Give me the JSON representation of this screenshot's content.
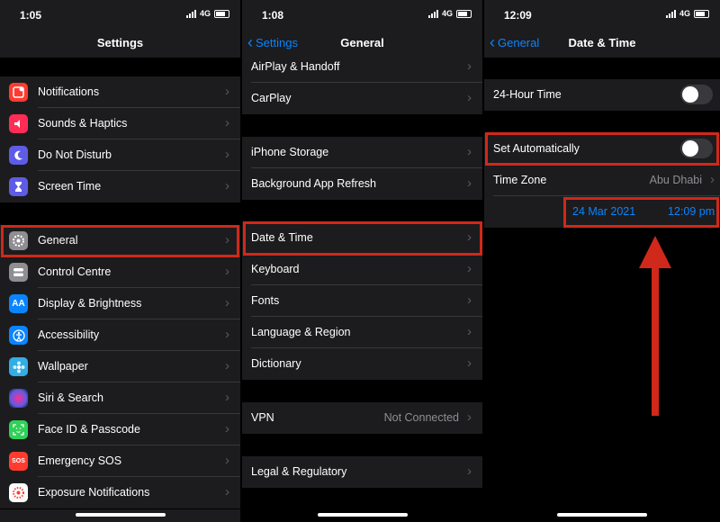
{
  "panels": {
    "p1": {
      "status_time": "1:05",
      "network": "4G",
      "title": "Settings",
      "items": [
        {
          "label": "Notifications",
          "icon": "notifications-icon",
          "color": "#ff3b30"
        },
        {
          "label": "Sounds & Haptics",
          "icon": "sounds-icon",
          "color": "#ff2d55"
        },
        {
          "label": "Do Not Disturb",
          "icon": "moon-icon",
          "color": "#5e5ce6"
        },
        {
          "label": "Screen Time",
          "icon": "hourglass-icon",
          "color": "#5e5ce6"
        },
        {
          "label": "General",
          "icon": "gear-icon",
          "color": "#8e8e93"
        },
        {
          "label": "Control Centre",
          "icon": "control-centre-icon",
          "color": "#8e8e93"
        },
        {
          "label": "Display & Brightness",
          "icon": "display-icon",
          "color": "#0a84ff",
          "glyph": "AA"
        },
        {
          "label": "Accessibility",
          "icon": "accessibility-icon",
          "color": "#0a84ff"
        },
        {
          "label": "Wallpaper",
          "icon": "wallpaper-icon",
          "color": "#32ade6"
        },
        {
          "label": "Siri & Search",
          "icon": "siri-icon",
          "color": "#1c1c1e"
        },
        {
          "label": "Face ID & Passcode",
          "icon": "face-id-icon",
          "color": "#30d158"
        },
        {
          "label": "Emergency SOS",
          "icon": "sos-icon",
          "color": "#ff3b30",
          "glyph": "SOS"
        },
        {
          "label": "Exposure Notifications",
          "icon": "exposure-icon",
          "color": "#ffffff"
        }
      ]
    },
    "p2": {
      "status_time": "1:08",
      "network": "4G",
      "back": "Settings",
      "title": "General",
      "items": [
        {
          "label": "AirPlay & Handoff"
        },
        {
          "label": "CarPlay"
        },
        {
          "label": "iPhone Storage"
        },
        {
          "label": "Background App Refresh"
        },
        {
          "label": "Date & Time"
        },
        {
          "label": "Keyboard"
        },
        {
          "label": "Fonts"
        },
        {
          "label": "Language & Region"
        },
        {
          "label": "Dictionary"
        },
        {
          "label": "VPN",
          "value": "Not Connected"
        },
        {
          "label": "Legal & Regulatory"
        }
      ]
    },
    "p3": {
      "status_time": "12:09",
      "network": "4G",
      "back": "General",
      "title": "Date & Time",
      "twenty_four_hour": "24-Hour Time",
      "twenty_four_hour_on": false,
      "set_automatically": "Set Automatically",
      "set_automatically_on": false,
      "time_zone_label": "Time Zone",
      "time_zone_value": "Abu Dhabi",
      "date": "24 Mar 2021",
      "time": "12:09 pm"
    }
  },
  "highlight_color": "#d0281a",
  "accent_color": "#0a84ff"
}
